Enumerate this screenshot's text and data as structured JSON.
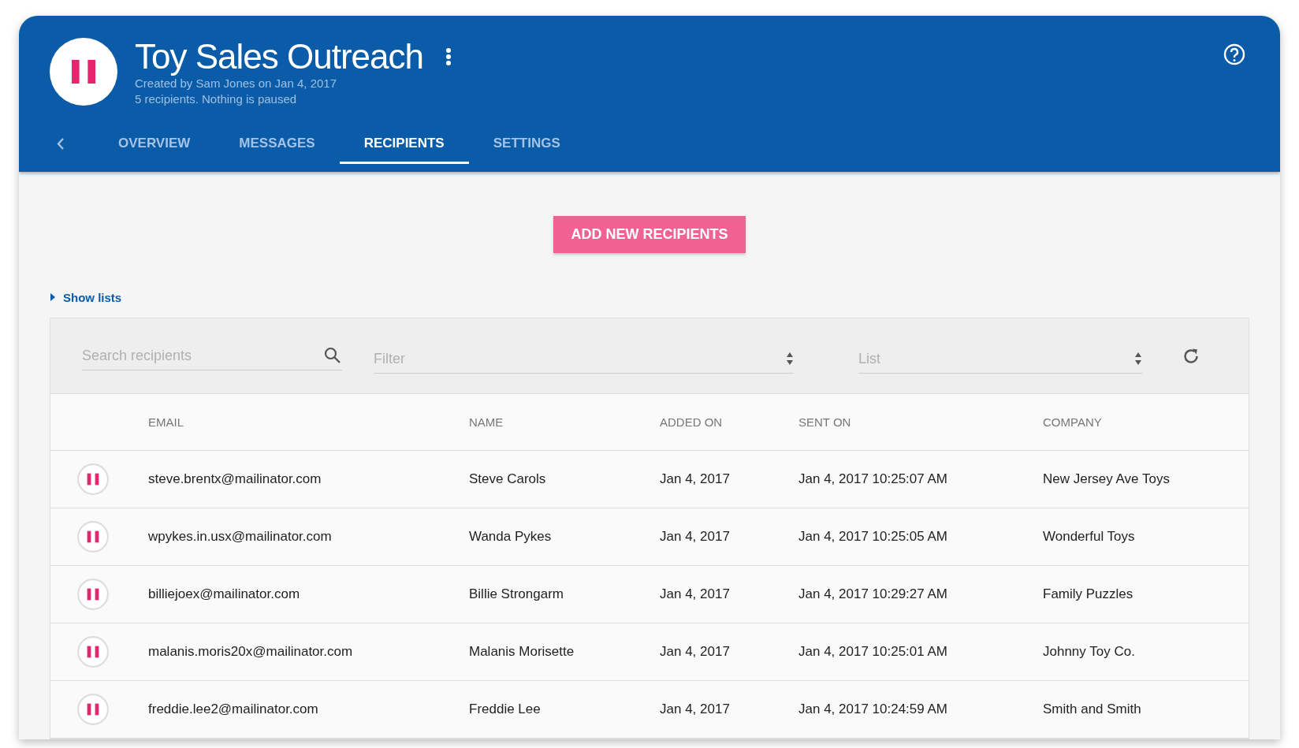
{
  "header": {
    "title": "Toy Sales Outreach",
    "subtitle_lines": [
      "Created by Sam Jones on Jan 4, 2017",
      "5 recipients. Nothing is paused"
    ]
  },
  "tabs": [
    {
      "label": "OVERVIEW",
      "selected": false
    },
    {
      "label": "MESSAGES",
      "selected": false
    },
    {
      "label": "RECIPIENTS",
      "selected": true
    },
    {
      "label": "SETTINGS",
      "selected": false
    }
  ],
  "add_button": "ADD NEW RECIPIENTS",
  "show_lists": "Show lists",
  "toolbar": {
    "search": {
      "placeholder": "Search recipients"
    },
    "filter": {
      "placeholder": "Filter"
    },
    "list": {
      "placeholder": "List"
    }
  },
  "table": {
    "columns": [
      "EMAIL",
      "NAME",
      "ADDED ON",
      "SENT ON",
      "COMPANY"
    ],
    "rows": [
      [
        "steve.brentx@mailinator.com",
        "Steve Carols",
        "Jan 4, 2017",
        "Jan 4, 2017 10:25:07 AM",
        "New Jersey Ave Toys"
      ],
      [
        "wpykes.in.usx@mailinator.com",
        "Wanda Pykes",
        "Jan 4, 2017",
        "Jan 4, 2017 10:25:05 AM",
        "Wonderful Toys"
      ],
      [
        "billiejoex@mailinator.com",
        "Billie Strongarm",
        "Jan 4, 2017",
        "Jan 4, 2017 10:29:27 AM",
        "Family Puzzles"
      ],
      [
        "malanis.moris20x@mailinator.com",
        "Malanis Morisette",
        "Jan 4, 2017",
        "Jan 4, 2017 10:25:01 AM",
        "Johnny Toy Co."
      ],
      [
        "freddie.lee2@mailinator.com",
        "Freddie Lee",
        "Jan 4, 2017",
        "Jan 4, 2017 10:24:59 AM",
        "Smith and Smith"
      ]
    ]
  }
}
